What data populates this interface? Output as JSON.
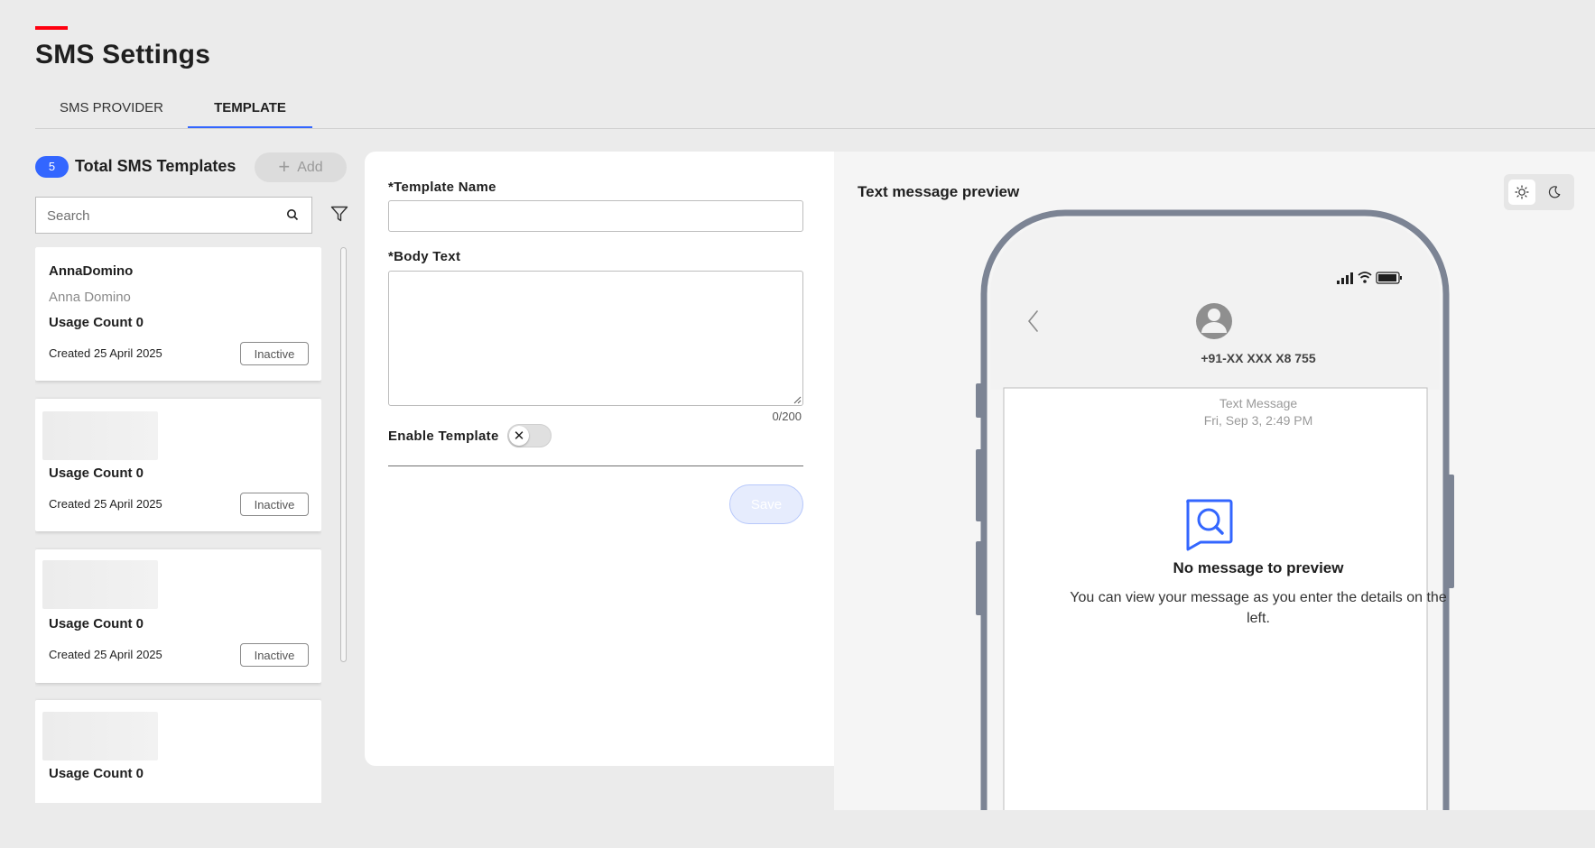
{
  "page": {
    "title": "SMS Settings",
    "accent_color": "#ff000f"
  },
  "tabs": [
    {
      "label": "SMS PROVIDER",
      "active": false
    },
    {
      "label": "TEMPLATE",
      "active": true
    }
  ],
  "templates_panel": {
    "count": "5",
    "count_label": "Total SMS Templates",
    "add_label": "Add",
    "search_placeholder": "Search",
    "cards": [
      {
        "title": "AnnaDomino",
        "subtitle": "Anna Domino",
        "usage": "Usage Count 0",
        "created": "Created 25 April 2025",
        "status": "Inactive"
      },
      {
        "usage": "Usage Count 0",
        "created": "Created 25 April 2025",
        "status": "Inactive"
      },
      {
        "usage": "Usage Count 0",
        "created": "Created 25 April 2025",
        "status": "Inactive"
      },
      {
        "usage": "Usage Count 0"
      }
    ]
  },
  "form": {
    "template_name_label": "*Template Name",
    "template_name_value": "",
    "body_text_label": "*Body Text",
    "body_text_value": "",
    "char_count": "0/200",
    "enable_template_label": "Enable Template",
    "enable_template_on": false,
    "save_label": "Save"
  },
  "preview": {
    "title": "Text message preview",
    "theme_options": [
      "light-icon",
      "moon-icon"
    ],
    "theme_selected": "light",
    "phone_number": "+91-XX XXX X8 755",
    "message_type": "Text Message",
    "timestamp": "Fri, Sep 3, 2:49 PM",
    "empty_title": "No message to preview",
    "empty_description": "You can view your message as you enter the details on the left."
  },
  "colors": {
    "primary": "#3366ff",
    "phone_frame": "#7c8494"
  }
}
